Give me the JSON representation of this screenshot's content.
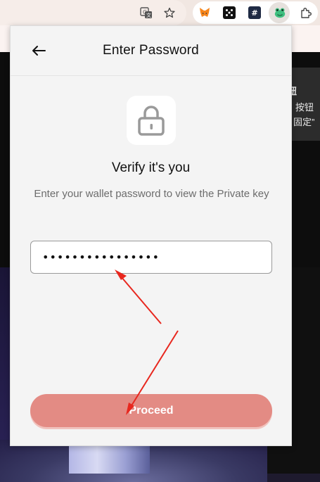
{
  "browser": {
    "translate_icon": "translate-icon",
    "bookmark_icon": "star-icon",
    "extensions": [
      {
        "name": "metamask-extension-icon",
        "glyph": "🦊",
        "color": "#f6851b"
      },
      {
        "name": "dice-extension-icon",
        "glyph": "⚄",
        "color": "#111111"
      },
      {
        "name": "hash-extension-icon",
        "glyph": "#",
        "color": "#1f2a44"
      },
      {
        "name": "frog-wallet-extension-icon",
        "glyph": "🐸",
        "color": "#3fbf7f"
      },
      {
        "name": "puzzle-extensions-icon",
        "glyph": "⧉",
        "color": "#4a4a4a"
      }
    ]
  },
  "background_page": {
    "tooltip_line1": "钮",
    "tooltip_line2": "按钮",
    "tooltip_line3": "固定”"
  },
  "popup": {
    "header_title": "Enter Password",
    "back_icon": "arrow-left-icon",
    "lock_icon": "lock-icon",
    "heading": "Verify it's you",
    "description": "Enter your wallet password to view the Private key",
    "password_value": "••••••••••••••••",
    "proceed_label": "Proceed",
    "accent_color": "#e38b84"
  }
}
